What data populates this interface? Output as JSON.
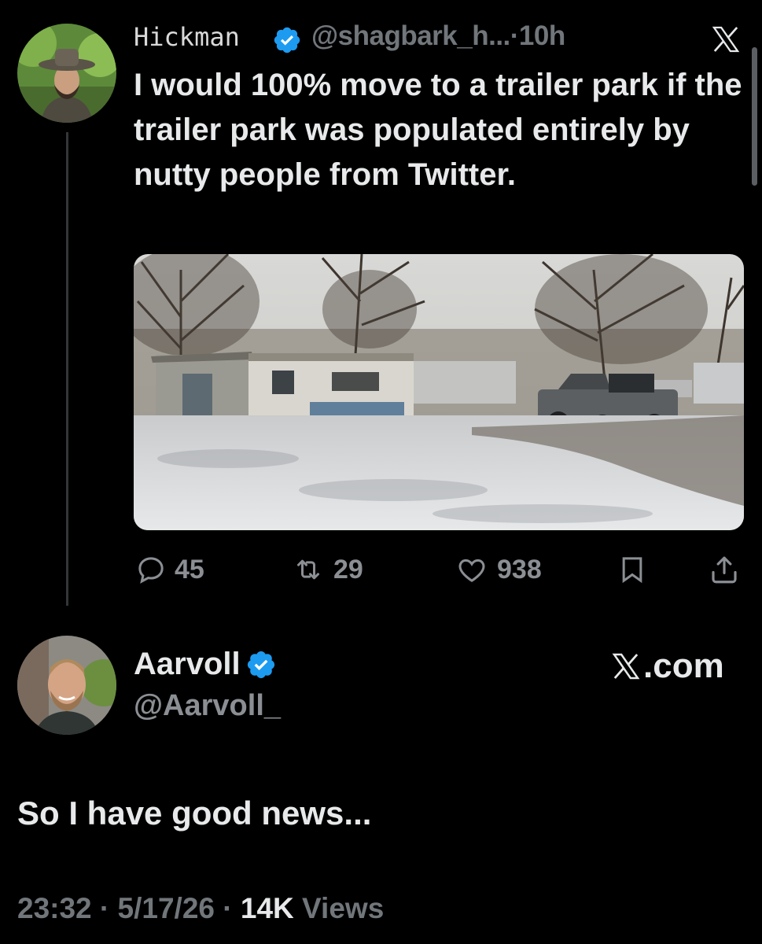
{
  "tweet": {
    "display_name": "Hickman",
    "handle": "@shagbark_h...",
    "separator": "·",
    "time": "10h",
    "text": "I would 100% move to a trailer park if the trailer park was populated entirely by nutty people from Twitter.",
    "media_description": "snowy trailer park with mobile homes, bare trees and a pickup truck",
    "actions": {
      "replies": "45",
      "reposts": "29",
      "likes": "938"
    }
  },
  "reply": {
    "display_name": "Aarvoll",
    "handle": "@Aarvoll_",
    "source_label": ".com",
    "text": "So I have good news...",
    "time": "23:32",
    "date": "5/17/26",
    "views_count": "14K",
    "views_label": "Views",
    "separator": "·"
  },
  "colors": {
    "background": "#000000",
    "text_primary": "#e7e9ea",
    "text_secondary": "#71767b",
    "verified_blue": "#1d9bf0"
  }
}
